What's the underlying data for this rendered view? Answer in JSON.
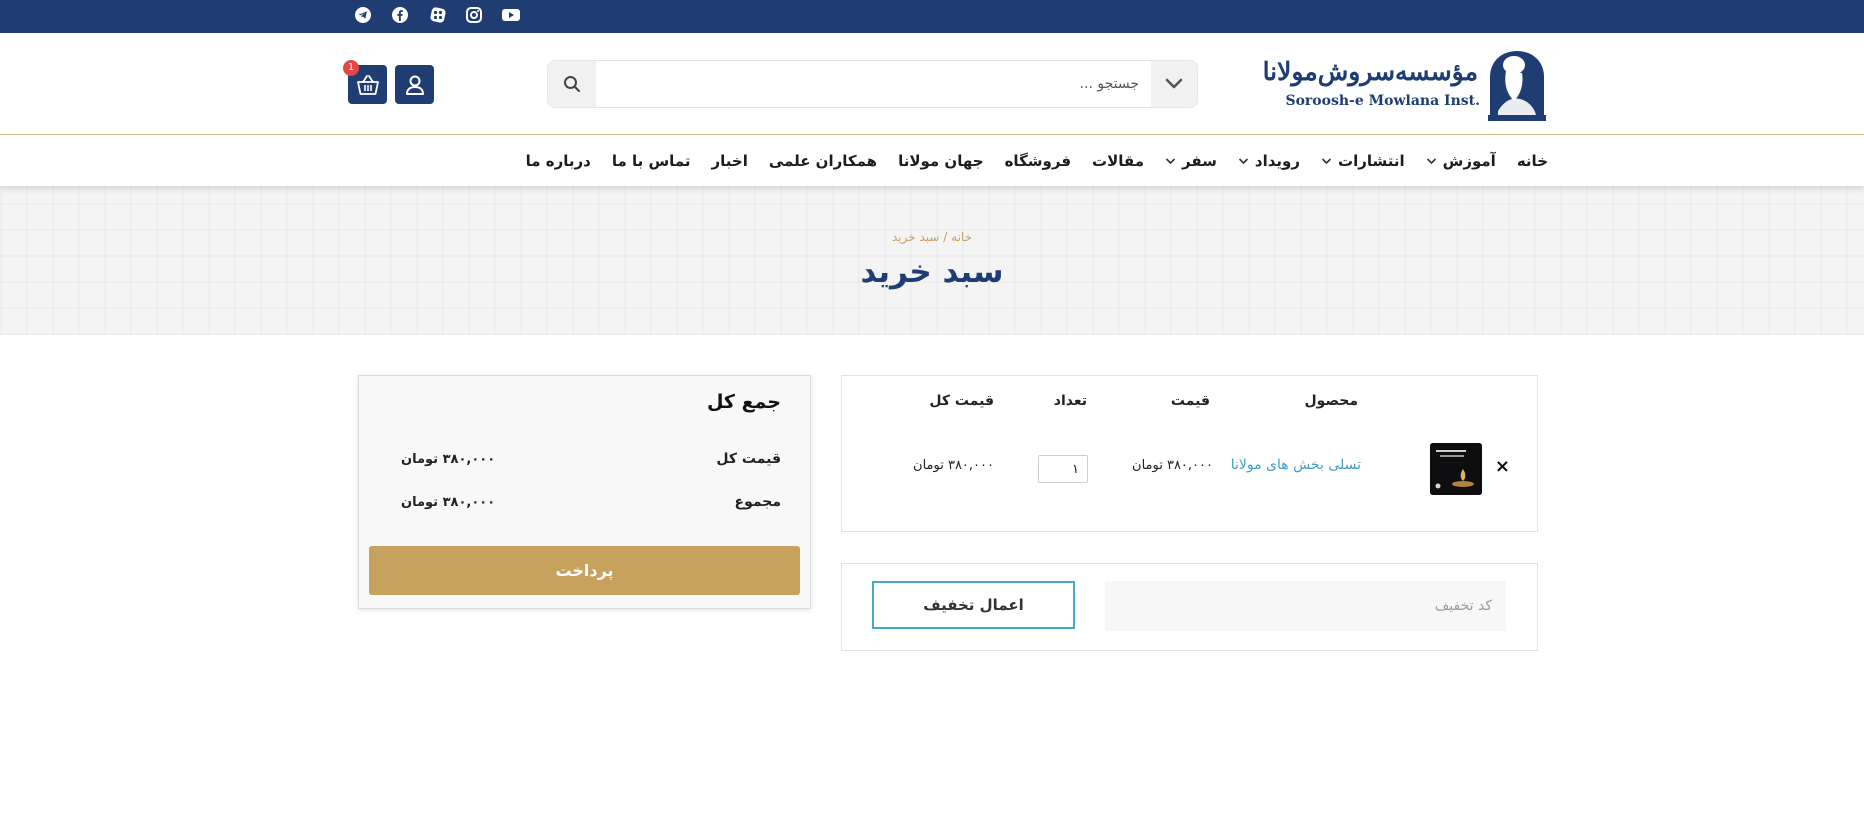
{
  "brand": {
    "name_fa": "مؤسسه‌سروش‌مولانا",
    "name_en": "Soroosh-e  Mowlana Inst.",
    "primary_color": "#1f3d73",
    "accent_color": "#c6a25e"
  },
  "social_icons": [
    "telegram-icon",
    "facebook-icon",
    "aparat-icon",
    "instagram-icon",
    "youtube-icon"
  ],
  "search": {
    "placeholder": "جستجو ..."
  },
  "header": {
    "cart_count": "1"
  },
  "nav": {
    "items": [
      {
        "label": "خانه",
        "dropdown": false
      },
      {
        "label": "آموزش",
        "dropdown": true
      },
      {
        "label": "انتشارات",
        "dropdown": true
      },
      {
        "label": "رویداد",
        "dropdown": true
      },
      {
        "label": "سفر",
        "dropdown": true
      },
      {
        "label": "مقالات",
        "dropdown": false
      },
      {
        "label": "فروشگاه",
        "dropdown": false
      },
      {
        "label": "جهان مولانا",
        "dropdown": false
      },
      {
        "label": "همکاران علمی",
        "dropdown": false
      },
      {
        "label": "اخبار",
        "dropdown": false
      },
      {
        "label": "تماس با ما",
        "dropdown": false
      },
      {
        "label": "درباره ما",
        "dropdown": false
      }
    ]
  },
  "hero": {
    "breadcrumb": "خانه / سبد خرید",
    "title": "سبد خرید"
  },
  "cart": {
    "headers": {
      "product": "محصول",
      "price": "قیمت",
      "quantity": "تعداد",
      "total": "قیمت کل"
    },
    "remove_symbol": "×",
    "items": [
      {
        "name": "تسلی بخش های مولانا",
        "price": "۳۸۰,۰۰۰ تومان",
        "quantity": "۱",
        "total": "۳۸۰,۰۰۰ تومان"
      }
    ]
  },
  "coupon": {
    "placeholder": "کد تخفیف",
    "apply_label": "اعمال تخفیف"
  },
  "totals": {
    "title": "جمع کل",
    "subtotal_label": "قیمت کل",
    "subtotal_value": "۳۸۰,۰۰۰ تومان",
    "total_label": "مجموع",
    "total_value": "۳۸۰,۰۰۰ تومان",
    "checkout_label": "پرداخت"
  }
}
